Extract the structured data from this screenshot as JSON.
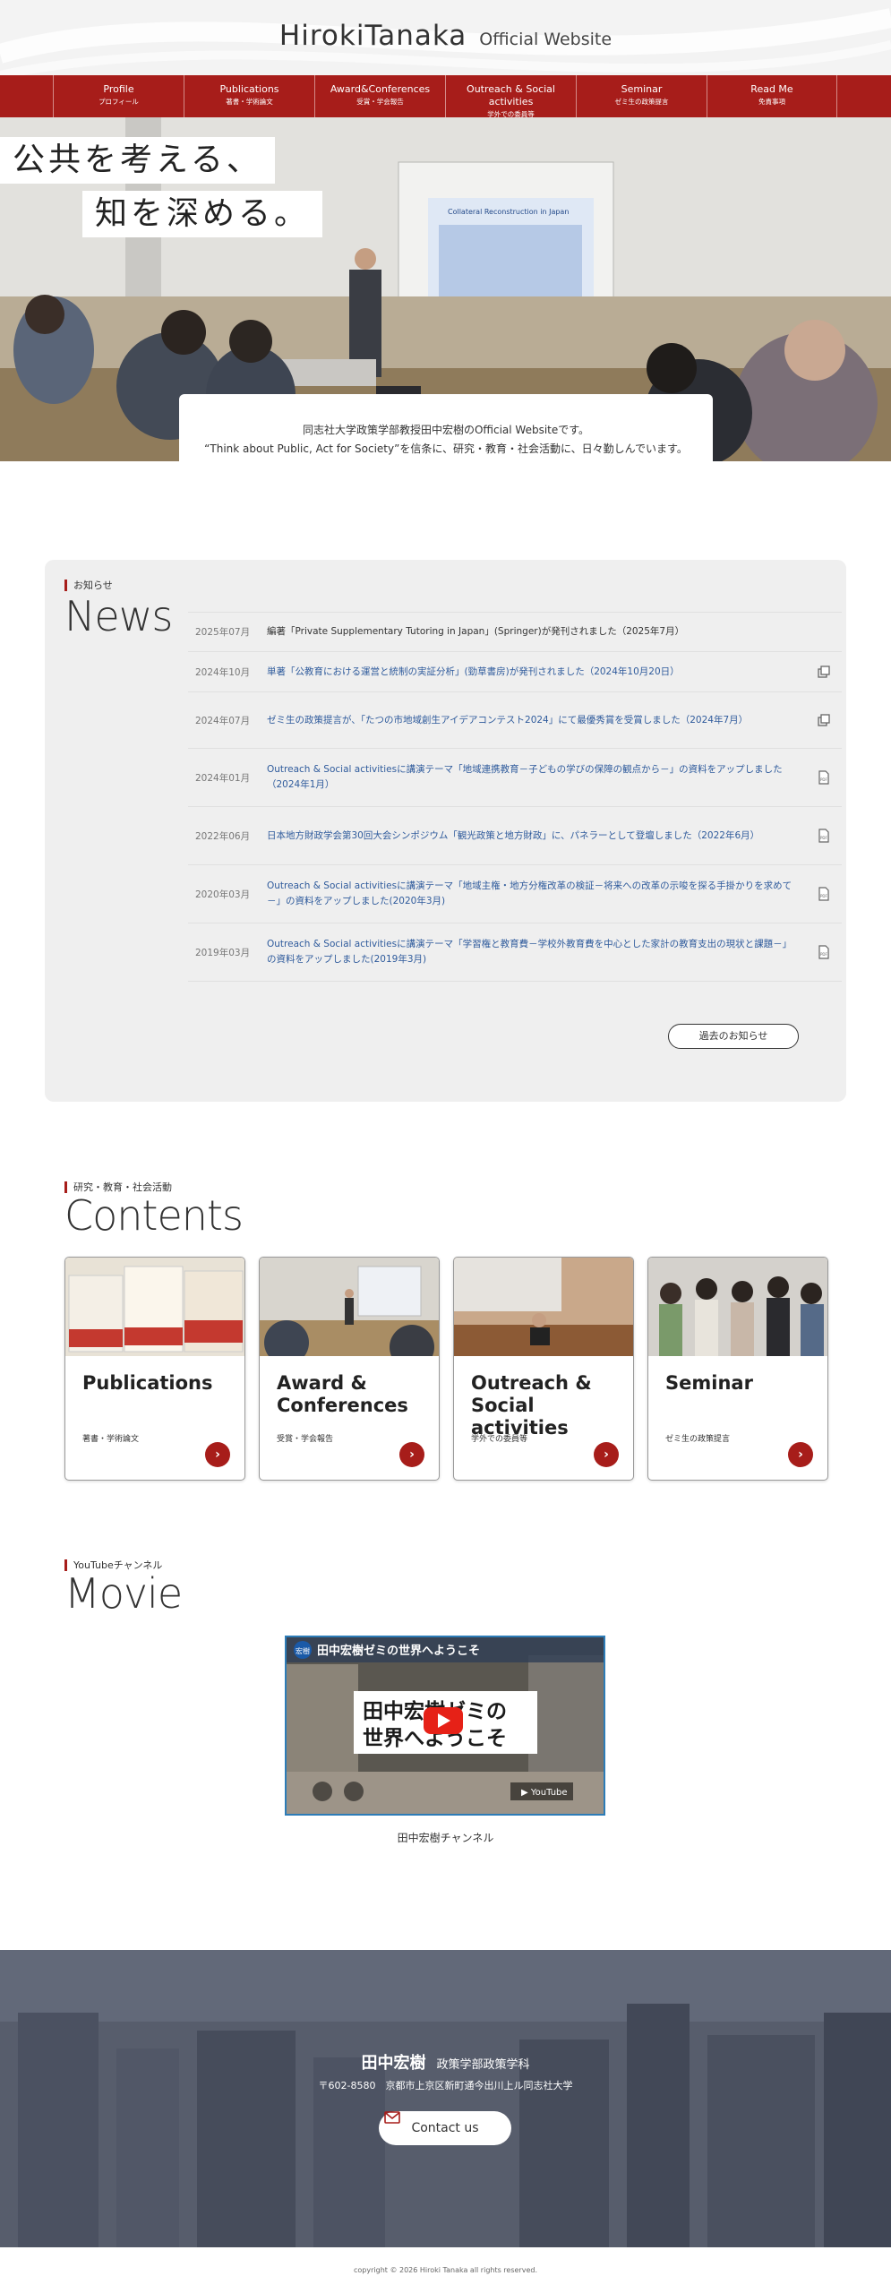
{
  "header": {
    "site_name": "HirokiTanaka",
    "site_sub": "Official Website"
  },
  "nav": [
    {
      "en": "Profile",
      "ja": "プロフィール"
    },
    {
      "en": "Publications",
      "ja": "著書・学術論文"
    },
    {
      "en": "Award&Conferences",
      "ja": "受賞・学会報告"
    },
    {
      "en": "Outreach & Social activities",
      "ja": "学外での委員等"
    },
    {
      "en": "Seminar",
      "ja": "ゼミ生の政策提言"
    },
    {
      "en": "Read Me",
      "ja": "免責事項"
    }
  ],
  "hero": {
    "catch_line1": "公共を考える、",
    "catch_line2": "知を深める。",
    "intro_line1": "同志社大学政策学部教授田中宏樹のOfficial Websiteです。",
    "intro_line2": "“Think about Public, Act for Society”を信条に、研究・教育・社会活動に、日々勤しんでいます。",
    "slide_title": "Collateral Reconstruction in Japan"
  },
  "news": {
    "tag": "お知らせ",
    "title": "News",
    "items": [
      {
        "date": "2025年07月",
        "title": "編著「Private Supplementary Tutoring in Japan」(Springer)が発刊されました（2025年7月）",
        "link": false,
        "icon": ""
      },
      {
        "date": "2024年10月",
        "title": "単著「公教育における運営と統制の実証分析」(勁草書房)が発刊されました（2024年10月20日）",
        "link": true,
        "icon": "external-link-icon"
      },
      {
        "date": "2024年07月",
        "title": "ゼミ生の政策提言が、「たつの市地域創生アイデアコンテスト2024」にて最優秀賞を受賞しました（2024年7月）",
        "link": true,
        "icon": "external-link-icon"
      },
      {
        "date": "2024年01月",
        "title": "Outreach & Social activitiesに講演テーマ「地域連携教育－子どもの学びの保障の観点から－」の資料をアップしました（2024年1月）",
        "link": true,
        "icon": "pdf-icon"
      },
      {
        "date": "2022年06月",
        "title": "日本地方財政学会第30回大会シンポジウム「観光政策と地方財政」に、パネラーとして登壇しました（2022年6月）",
        "link": true,
        "icon": "pdf-icon"
      },
      {
        "date": "2020年03月",
        "title": "Outreach & Social activitiesに講演テーマ「地域主権・地方分権改革の検証－将来への改革の示唆を探る手掛かりを求めて－」の資料をアップしました(2020年3月)",
        "link": true,
        "icon": "pdf-icon"
      },
      {
        "date": "2019年03月",
        "title": "Outreach & Social activitiesに講演テーマ「学習権と教育費－学校外教育費を中心とした家計の教育支出の現状と課題－」の資料をアップしました(2019年3月)",
        "link": true,
        "icon": "pdf-icon"
      }
    ],
    "past_button": "過去のお知らせ"
  },
  "contents": {
    "tag": "研究・教育・社会活動",
    "title": "Contents",
    "cards": [
      {
        "title_line1": "Publications",
        "title_line2": "",
        "sub": "著書・学術論文"
      },
      {
        "title_line1": "Award &",
        "title_line2": "Conferences",
        "sub": "受賞・学会報告"
      },
      {
        "title_line1": "Outreach &",
        "title_line2": "Social activities",
        "sub": "学外での委員等"
      },
      {
        "title_line1": "Seminar",
        "title_line2": "",
        "sub": "ゼミ生の政策提言"
      }
    ]
  },
  "movie": {
    "tag": "YouTubeチャンネル",
    "title": "Movie",
    "video_title": "田中宏樹ゼミの世界へようこそ",
    "video_big_line1": "田中宏樹ゼミの",
    "video_big_line2": "世界へようこそ",
    "channel_badge": "宏樹",
    "caption": "田中宏樹チャンネル"
  },
  "footer": {
    "name": "田中宏樹",
    "dept": "政策学部政策学科",
    "address": "〒602-8580　京都市上京区新町通今出川上ル同志社大学",
    "contact": "Contact us",
    "copyright": "copyright © 2026 Hiroki Tanaka all rights reserved."
  },
  "colors": {
    "accent": "#a71d1a",
    "link": "#2f5b9c",
    "news_bg": "#efefef"
  }
}
